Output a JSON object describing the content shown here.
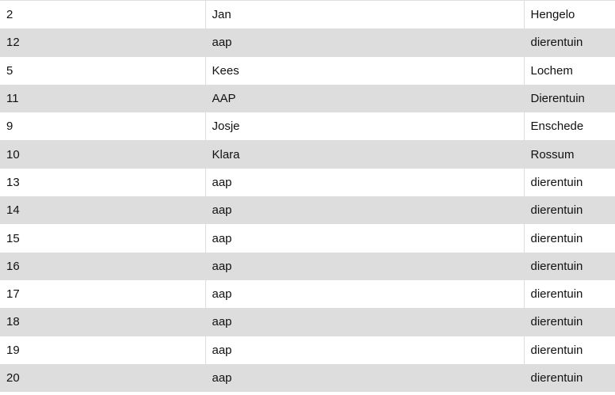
{
  "colors": {
    "row_odd": "#ffffff",
    "row_even": "#dddddd",
    "border": "#dddddd",
    "text": "#111111"
  },
  "table": {
    "rows": [
      {
        "id": "2",
        "name": "Jan",
        "place": "Hengelo"
      },
      {
        "id": "12",
        "name": "aap",
        "place": "dierentuin"
      },
      {
        "id": "5",
        "name": "Kees",
        "place": "Lochem"
      },
      {
        "id": "11",
        "name": "AAP",
        "place": "Dierentuin"
      },
      {
        "id": "9",
        "name": "Josje",
        "place": "Enschede"
      },
      {
        "id": "10",
        "name": "Klara",
        "place": "Rossum"
      },
      {
        "id": "13",
        "name": "aap",
        "place": "dierentuin"
      },
      {
        "id": "14",
        "name": "aap",
        "place": "dierentuin"
      },
      {
        "id": "15",
        "name": "aap",
        "place": "dierentuin"
      },
      {
        "id": "16",
        "name": "aap",
        "place": "dierentuin"
      },
      {
        "id": "17",
        "name": "aap",
        "place": "dierentuin"
      },
      {
        "id": "18",
        "name": "aap",
        "place": "dierentuin"
      },
      {
        "id": "19",
        "name": "aap",
        "place": "dierentuin"
      },
      {
        "id": "20",
        "name": "aap",
        "place": "dierentuin"
      }
    ]
  }
}
